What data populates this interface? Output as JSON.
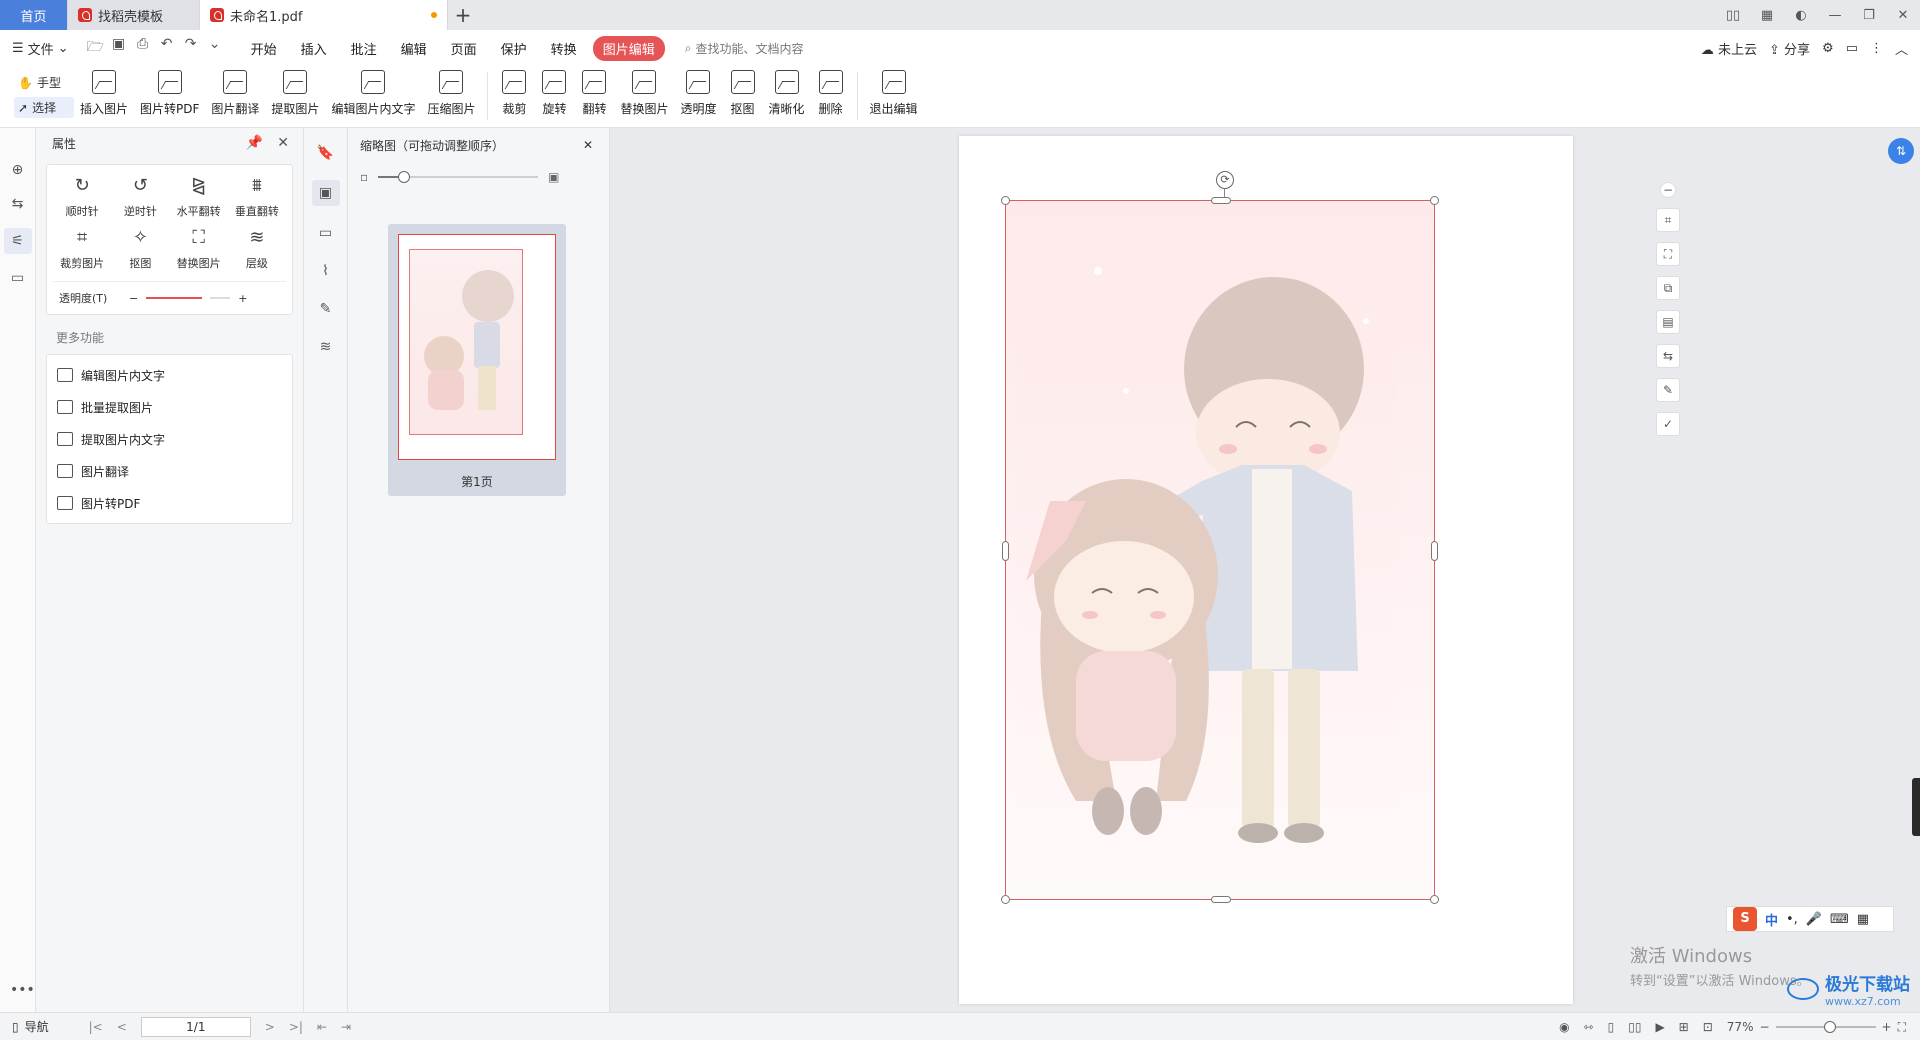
{
  "tabs": {
    "home": "首页",
    "template": "找稻壳模板",
    "document": "未命名1.pdf",
    "new_tab": "+"
  },
  "menubar": {
    "file": "文件",
    "items": [
      "开始",
      "插入",
      "批注",
      "编辑",
      "页面",
      "保护",
      "转换"
    ],
    "active": "图片编辑",
    "search_placeholder": "查找功能、文档内容",
    "cloud": "未上云",
    "share": "分享"
  },
  "ribbon": {
    "hand": "手型",
    "select": "选择",
    "group1": [
      "插入图片",
      "图片转PDF",
      "图片翻译",
      "提取图片",
      "编辑图片内文字",
      "压缩图片"
    ],
    "group2": [
      "裁剪",
      "旋转",
      "翻转",
      "替换图片",
      "透明度",
      "抠图",
      "清晰化",
      "删除"
    ],
    "exit": "退出编辑"
  },
  "props": {
    "title": "属性",
    "tools": [
      "顺时针",
      "逆时针",
      "水平翻转",
      "垂直翻转",
      "裁剪图片",
      "抠图",
      "替换图片",
      "层级"
    ],
    "opacity_label": "透明度(T)",
    "opacity_value": 0.6,
    "more_title": "更多功能",
    "more_items": [
      "编辑图片内文字",
      "批量提取图片",
      "提取图片内文字",
      "图片翻译",
      "图片转PDF"
    ]
  },
  "thumbs": {
    "title": "缩略图（可拖动调整顺序）",
    "page_label": "第1页"
  },
  "overlay": {
    "win_activate_1": "激活 Windows",
    "win_activate_2": "转到“设置”以激活 Windows。",
    "ime_zh": "中",
    "watermark": "极光下载站",
    "watermark_url": "www.xz7.com"
  },
  "statusbar": {
    "nav": "导航",
    "page": "1/1",
    "zoom": "77%"
  },
  "colors": {
    "accent": "#4a7fdc",
    "active_tab": "#e65555",
    "selection": "#d9605c"
  }
}
